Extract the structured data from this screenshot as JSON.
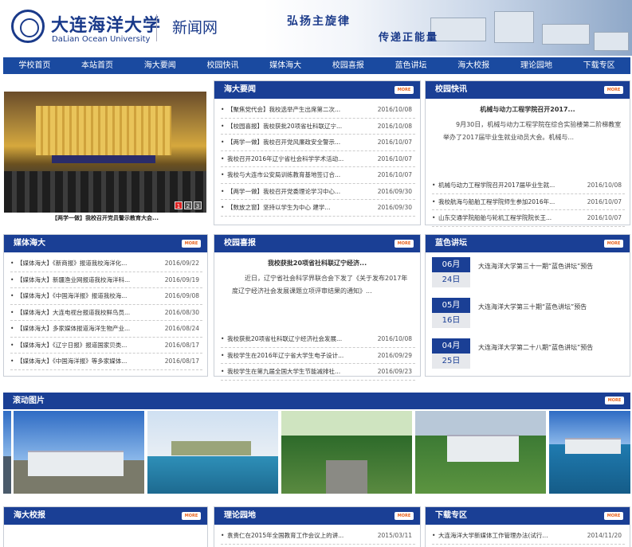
{
  "header": {
    "cn_name": "大连海洋大学",
    "en_name": "DaLian Ocean University",
    "site_name": "新闻网",
    "slogan_1": "弘扬主旋律",
    "slogan_2": "传递正能量"
  },
  "nav": [
    "学校首页",
    "本站首页",
    "海大要闻",
    "校园快讯",
    "媒体海大",
    "校园喜报",
    "蓝色讲坛",
    "海大校报",
    "理论园地",
    "下载专区"
  ],
  "more_label": "MORE",
  "slide": {
    "caption": "【两学一做】我校召开党员警示教育大会...",
    "pages": [
      "1",
      "2",
      "3"
    ]
  },
  "news": {
    "title": "海大要闻",
    "items": [
      {
        "t": "【聚焦党代会】我校选举产生出席第二次...",
        "d": "2016/10/08"
      },
      {
        "t": "【校园喜报】我校获批20项省社科联辽宁...",
        "d": "2016/10/08"
      },
      {
        "t": "【两学一做】我校召开党风廉政安全警示...",
        "d": "2016/10/07"
      },
      {
        "t": "我校召开2016年辽宁省社会科学学术活动...",
        "d": "2016/10/07"
      },
      {
        "t": "我校与大连市公安局训练教育基地签订合...",
        "d": "2016/10/07"
      },
      {
        "t": "【两学一做】我校召开党委理论学习中心...",
        "d": "2016/09/30"
      },
      {
        "t": "【数放之窗】坚持以学生为中心 建学...",
        "d": "2016/09/30"
      }
    ]
  },
  "quick": {
    "title": "校园快讯",
    "feature_title": "机械与动力工程学院召开2017...",
    "feature_body": "9月30日，机械与动力工程学院在综合实验楼第二阶梯教室举办了2017届毕业生就业动员大会。机械与...",
    "items": [
      {
        "t": "机械与动力工程学院召开2017届毕业生就...",
        "d": "2016/10/08"
      },
      {
        "t": "我校航海与船舶工程学院师生参加2016年...",
        "d": "2016/10/07"
      },
      {
        "t": "山东交通学院船舶与轮机工程学院院长王...",
        "d": "2016/10/07"
      }
    ]
  },
  "media": {
    "title": "媒体海大",
    "items": [
      {
        "t": "【媒体海大】《新商报》报道我校海洋化...",
        "d": "2016/09/22"
      },
      {
        "t": "【媒体海大】新疆渔业网报道我校海洋科...",
        "d": "2016/09/19"
      },
      {
        "t": "【媒体海大】《中国海洋报》报道我校海...",
        "d": "2016/09/08"
      },
      {
        "t": "【媒体海大】大连电视台报道我校鲜鸟员...",
        "d": "2016/08/30"
      },
      {
        "t": "【媒体海大】多家媒体报道海洋生物产业...",
        "d": "2016/08/24"
      },
      {
        "t": "【媒体海大】《辽宁日报》报道国家贝类...",
        "d": "2016/08/17"
      },
      {
        "t": "【媒体海大】《中国海洋报》等多家媒体...",
        "d": "2016/08/17"
      }
    ]
  },
  "honor": {
    "title": "校园喜报",
    "feature_title": "我校获批20项省社科联辽宁经济...",
    "feature_body": "近日，辽宁省社会科学界联合会下发了《关于发布2017年度辽宁经济社会发展课题立项评审结果的通知》...",
    "items": [
      {
        "t": "我校获批20项省社科联辽宁经济社会发展...",
        "d": "2016/10/08"
      },
      {
        "t": "我校学生在2016年辽宁省大学生电子设计...",
        "d": "2016/09/29"
      },
      {
        "t": "我校学生在第九届全国大学生节能减排社...",
        "d": "2016/09/23"
      }
    ]
  },
  "lecture": {
    "title": "蓝色讲坛",
    "items": [
      {
        "m": "06月",
        "d": "24日",
        "t": "大连海洋大学第三十一期“蓝色讲坛”预告"
      },
      {
        "m": "05月",
        "d": "16日",
        "t": "大连海洋大学第三十期“蓝色讲坛”预告"
      },
      {
        "m": "04月",
        "d": "25日",
        "t": "大连海洋大学第二十八期“蓝色讲坛”预告"
      }
    ]
  },
  "rolling": {
    "title": "滚动图片"
  },
  "paper": {
    "title": "海大校报"
  },
  "theory": {
    "title": "理论园地",
    "items": [
      {
        "t": "袁贵仁在2015年全国教育工作会议上的讲...",
        "d": "2015/03/11"
      }
    ]
  },
  "download": {
    "title": "下载专区",
    "items": [
      {
        "t": "大连海洋大学新媒体工作管理办法(试行...",
        "d": "2014/11/20"
      }
    ]
  }
}
